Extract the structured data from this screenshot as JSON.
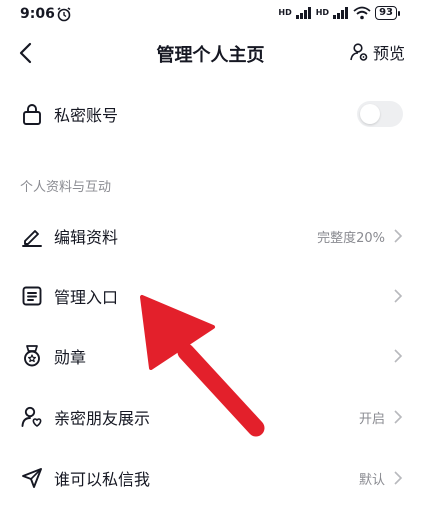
{
  "status_bar": {
    "time": "9:06",
    "network_1": "HD",
    "network_2": "HD",
    "battery": "93"
  },
  "header": {
    "title": "管理个人主页",
    "preview_label": "预览"
  },
  "private_account": {
    "label": "私密账号",
    "enabled": false
  },
  "section_title": "个人资料与互动",
  "items": [
    {
      "label": "编辑资料",
      "value": "完整度20%",
      "icon": "edit-icon"
    },
    {
      "label": "管理入口",
      "value": "",
      "icon": "list-icon"
    },
    {
      "label": "勋章",
      "value": "",
      "icon": "medal-icon"
    },
    {
      "label": "亲密朋友展示",
      "value": "开启",
      "icon": "close-friends-icon"
    },
    {
      "label": "谁可以私信我",
      "value": "默认",
      "icon": "send-icon"
    }
  ],
  "colors": {
    "annotation_arrow": "#e3202b",
    "secondary_text": "#8a8b91",
    "primary_text": "#161823"
  }
}
